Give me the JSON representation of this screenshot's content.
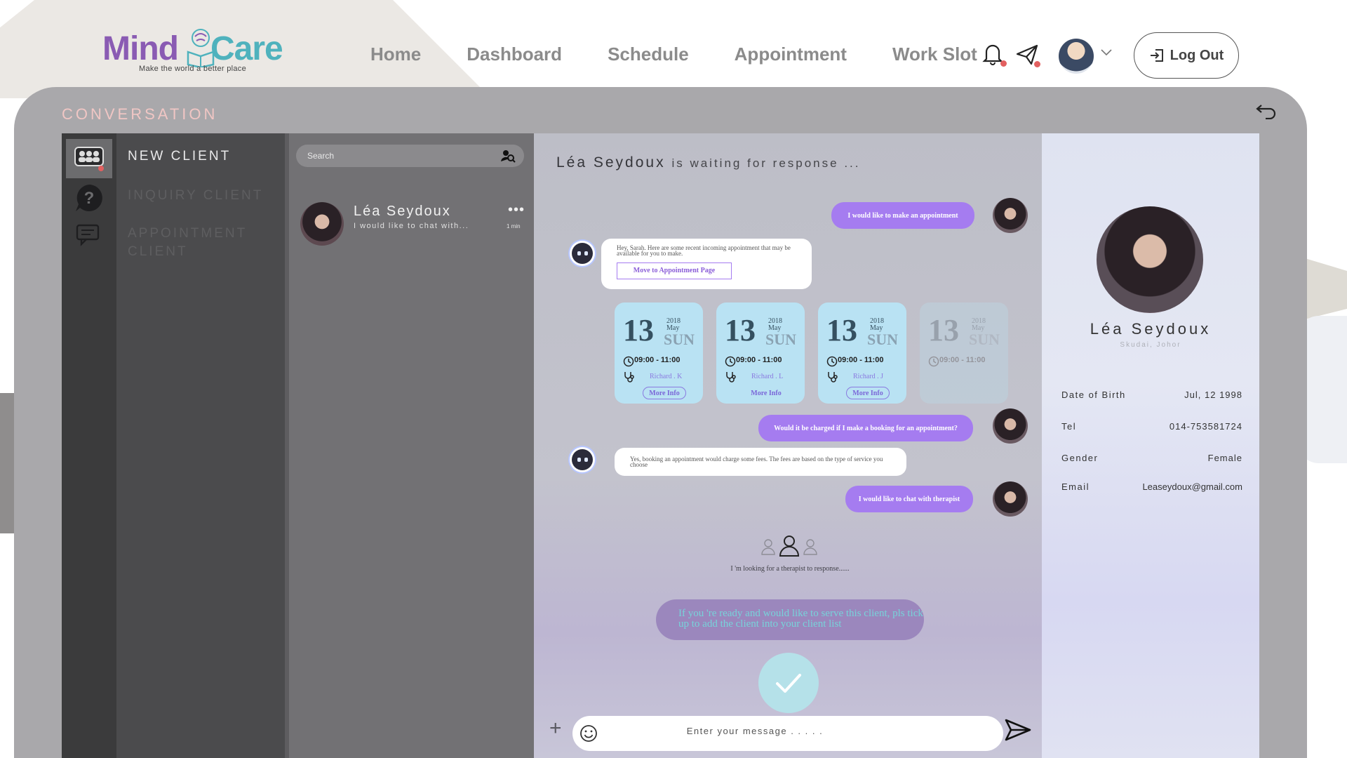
{
  "brand": {
    "name_part1": "Mind",
    "name_part2": "Care",
    "tagline": "Make the world a better place",
    "colors": {
      "mind": "#8a5bb3",
      "care": "#4fb2bd"
    }
  },
  "nav": {
    "items": [
      "Home",
      "Dashboard",
      "Schedule",
      "Appointment",
      "Work Slot"
    ]
  },
  "header": {
    "icons": {
      "notifications": "bell-icon",
      "messages": "paper-plane-icon",
      "profile_menu": "chevron-down-icon"
    },
    "logout_label": "Log Out"
  },
  "conversation": {
    "title": "CONVERSATION",
    "back_icon": "undo-arrow-icon"
  },
  "menu": {
    "items": [
      {
        "label": "NEW CLIENT",
        "icon": "group-icon",
        "active": true
      },
      {
        "label": "INQUIRY CLIENT",
        "icon": "question-icon",
        "active": false
      },
      {
        "label": "APPOINTMENT CLIENT",
        "icon": "chat-icon",
        "active": false
      }
    ]
  },
  "client_list": {
    "search_placeholder": "Search",
    "clients": [
      {
        "name": "Léa Seydoux",
        "preview": "I would like to chat with...",
        "time": "1 min"
      }
    ]
  },
  "chat": {
    "header_name": "Léa Seydoux",
    "header_status": "is waiting for response ...",
    "messages": [
      {
        "from": "client",
        "text": "I would like to make an appointment"
      },
      {
        "from": "bot",
        "text": "Hey, Sarah. Here are some recent incoming appointment that may be available for you to make.",
        "button": "Move to Appointment Page"
      },
      {
        "from": "client",
        "text": "Would it be charged if I make a booking for an appointment?"
      },
      {
        "from": "bot",
        "text": "Yes, booking an appointment would charge some fees. The fees are based on the type of service you choose"
      },
      {
        "from": "client",
        "text": "I would like to chat with therapist"
      }
    ],
    "slots": [
      {
        "day": "13",
        "year": "2018",
        "month": "May",
        "weekday": "SUN",
        "time": "09:00 - 11:00",
        "therapist": "Richard . K",
        "more": "More Info"
      },
      {
        "day": "13",
        "year": "2018",
        "month": "May",
        "weekday": "SUN",
        "time": "09:00 - 11:00",
        "therapist": "Richard . L",
        "more": "More Info"
      },
      {
        "day": "13",
        "year": "2018",
        "month": "May",
        "weekday": "SUN",
        "time": "09:00 - 11:00",
        "therapist": "Richard . J",
        "more": "More Info"
      },
      {
        "day": "13",
        "year": "2018",
        "month": "May",
        "weekday": "SUN",
        "time": "09:00 - 11:00",
        "therapist": "",
        "more": ""
      }
    ],
    "waiting_text": "I 'm looking for a therapist to response......",
    "accept_note": "If you 're ready and would like to serve this client, pls tick up to add the client into your client list",
    "message_placeholder": "Enter your message . . . . .",
    "colors": {
      "client_bubble": "#a57cf0",
      "slot_card": "#b9e2f3",
      "accept_button": "#b5e1e9"
    }
  },
  "profile": {
    "name": "Léa Seydoux",
    "location": "Skudai, Johor",
    "fields": [
      {
        "label": "Date of Birth",
        "value": "Jul, 12 1998"
      },
      {
        "label": "Tel",
        "value": "014-753581724"
      },
      {
        "label": "Gender",
        "value": "Female"
      },
      {
        "label": "Email",
        "value": "Leaseydoux@gmail.com"
      }
    ]
  }
}
